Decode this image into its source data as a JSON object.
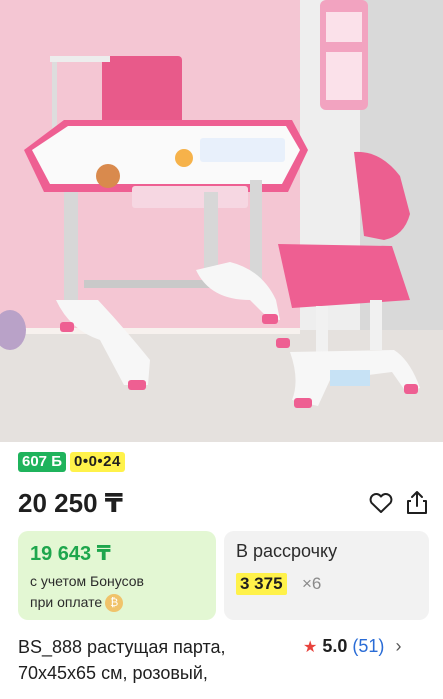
{
  "product": {
    "image_alt": "pink children's desk and chair",
    "badges": {
      "bonus": "607 Б",
      "installment": "0•0•24"
    },
    "price": "20 250 ₸",
    "actions": {
      "favorite_icon": "heart-icon",
      "share_icon": "share-icon"
    },
    "bonus_card": {
      "price": "19 643 ₸",
      "line1": "с учетом Бонусов",
      "line2": "при оплате",
      "coin_icon": "₿"
    },
    "installment_card": {
      "title": "В рассрочку",
      "amount": "3 375",
      "multiplier": "×6"
    },
    "title_line1": "BS_888 растущая парта,",
    "title_line2": "70x45x65 см, розовый,",
    "rating": {
      "star": "★",
      "score": "5.0",
      "count": "(51)",
      "chevron": "›"
    }
  },
  "colors": {
    "accent_green": "#1fb35c",
    "installment_yellow": "#fff24a",
    "bonus_card_bg": "#e3f7d3",
    "star_red": "#e8423c",
    "link_blue": "#2a6cd6"
  }
}
